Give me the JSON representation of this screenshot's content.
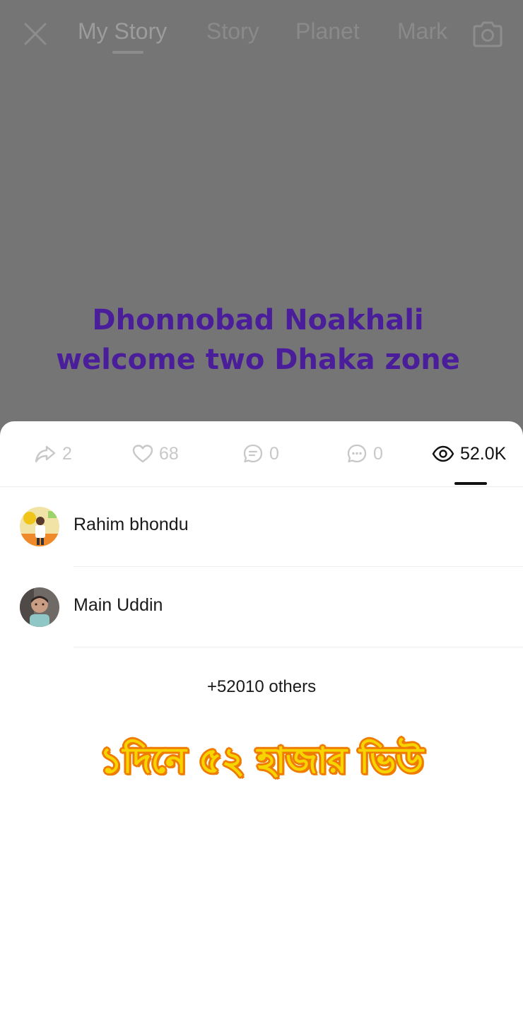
{
  "header": {
    "tabs": [
      {
        "label": "My Story"
      },
      {
        "label": "Story"
      },
      {
        "label": "Planet"
      },
      {
        "label": "Mark"
      }
    ]
  },
  "story": {
    "caption": "Dhonnobad Noakhali welcome two Dhaka zone"
  },
  "stats": {
    "shares": "2",
    "likes": "68",
    "comments": "0",
    "replies": "0",
    "views": "52.0K"
  },
  "viewers": [
    {
      "name": "Rahim bhondu"
    },
    {
      "name": "Main Uddin"
    }
  ],
  "others_label": "+52010 others",
  "overlay_text": "১দিনে ৫২ হাজার ভিউ",
  "colors": {
    "backdrop": "#757575",
    "caption": "#4a1d9a",
    "overlay_fill": "#f6d400",
    "overlay_outline": "#ef7b00"
  }
}
